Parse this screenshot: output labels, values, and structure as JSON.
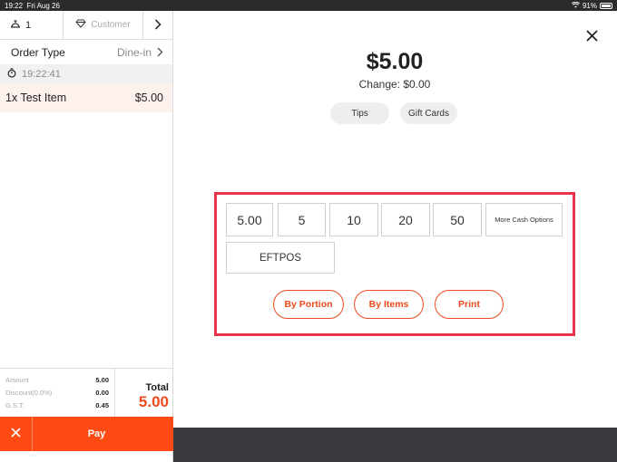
{
  "status_bar": {
    "time": "19:22",
    "date": "Fri Aug 26",
    "battery": "91%"
  },
  "order_header": {
    "seat_count": "1",
    "customer_label": "Customer"
  },
  "order_type": {
    "label": "Order Type",
    "value": "Dine-in"
  },
  "timer": "19:22:41",
  "items": [
    {
      "name": "1x Test Item",
      "price": "$5.00"
    }
  ],
  "summary": {
    "amount_label": "Amount",
    "amount_value": "5.00",
    "discount_label": "Discount(0.0%)",
    "discount_value": "0.00",
    "gst_label": "G.S.T.",
    "gst_value": "0.45",
    "total_label": "Total",
    "total_value": "5.00"
  },
  "pay_bar": {
    "pay_label": "Pay"
  },
  "payment": {
    "amount_due": "$5.00",
    "change_text": "Change: $0.00",
    "tips_label": "Tips",
    "gift_cards_label": "Gift Cards",
    "cash_options": [
      "5.00",
      "5",
      "10",
      "20",
      "50"
    ],
    "more_cash_label": "More Cash Options",
    "eftpos_label": "EFTPOS",
    "split_by_portion_label": "By Portion",
    "split_by_items_label": "By Items",
    "print_label": "Print"
  },
  "colors": {
    "accent": "#ff4b13",
    "highlight_border": "#e8344a",
    "dark_bar": "#3a3b3e"
  }
}
